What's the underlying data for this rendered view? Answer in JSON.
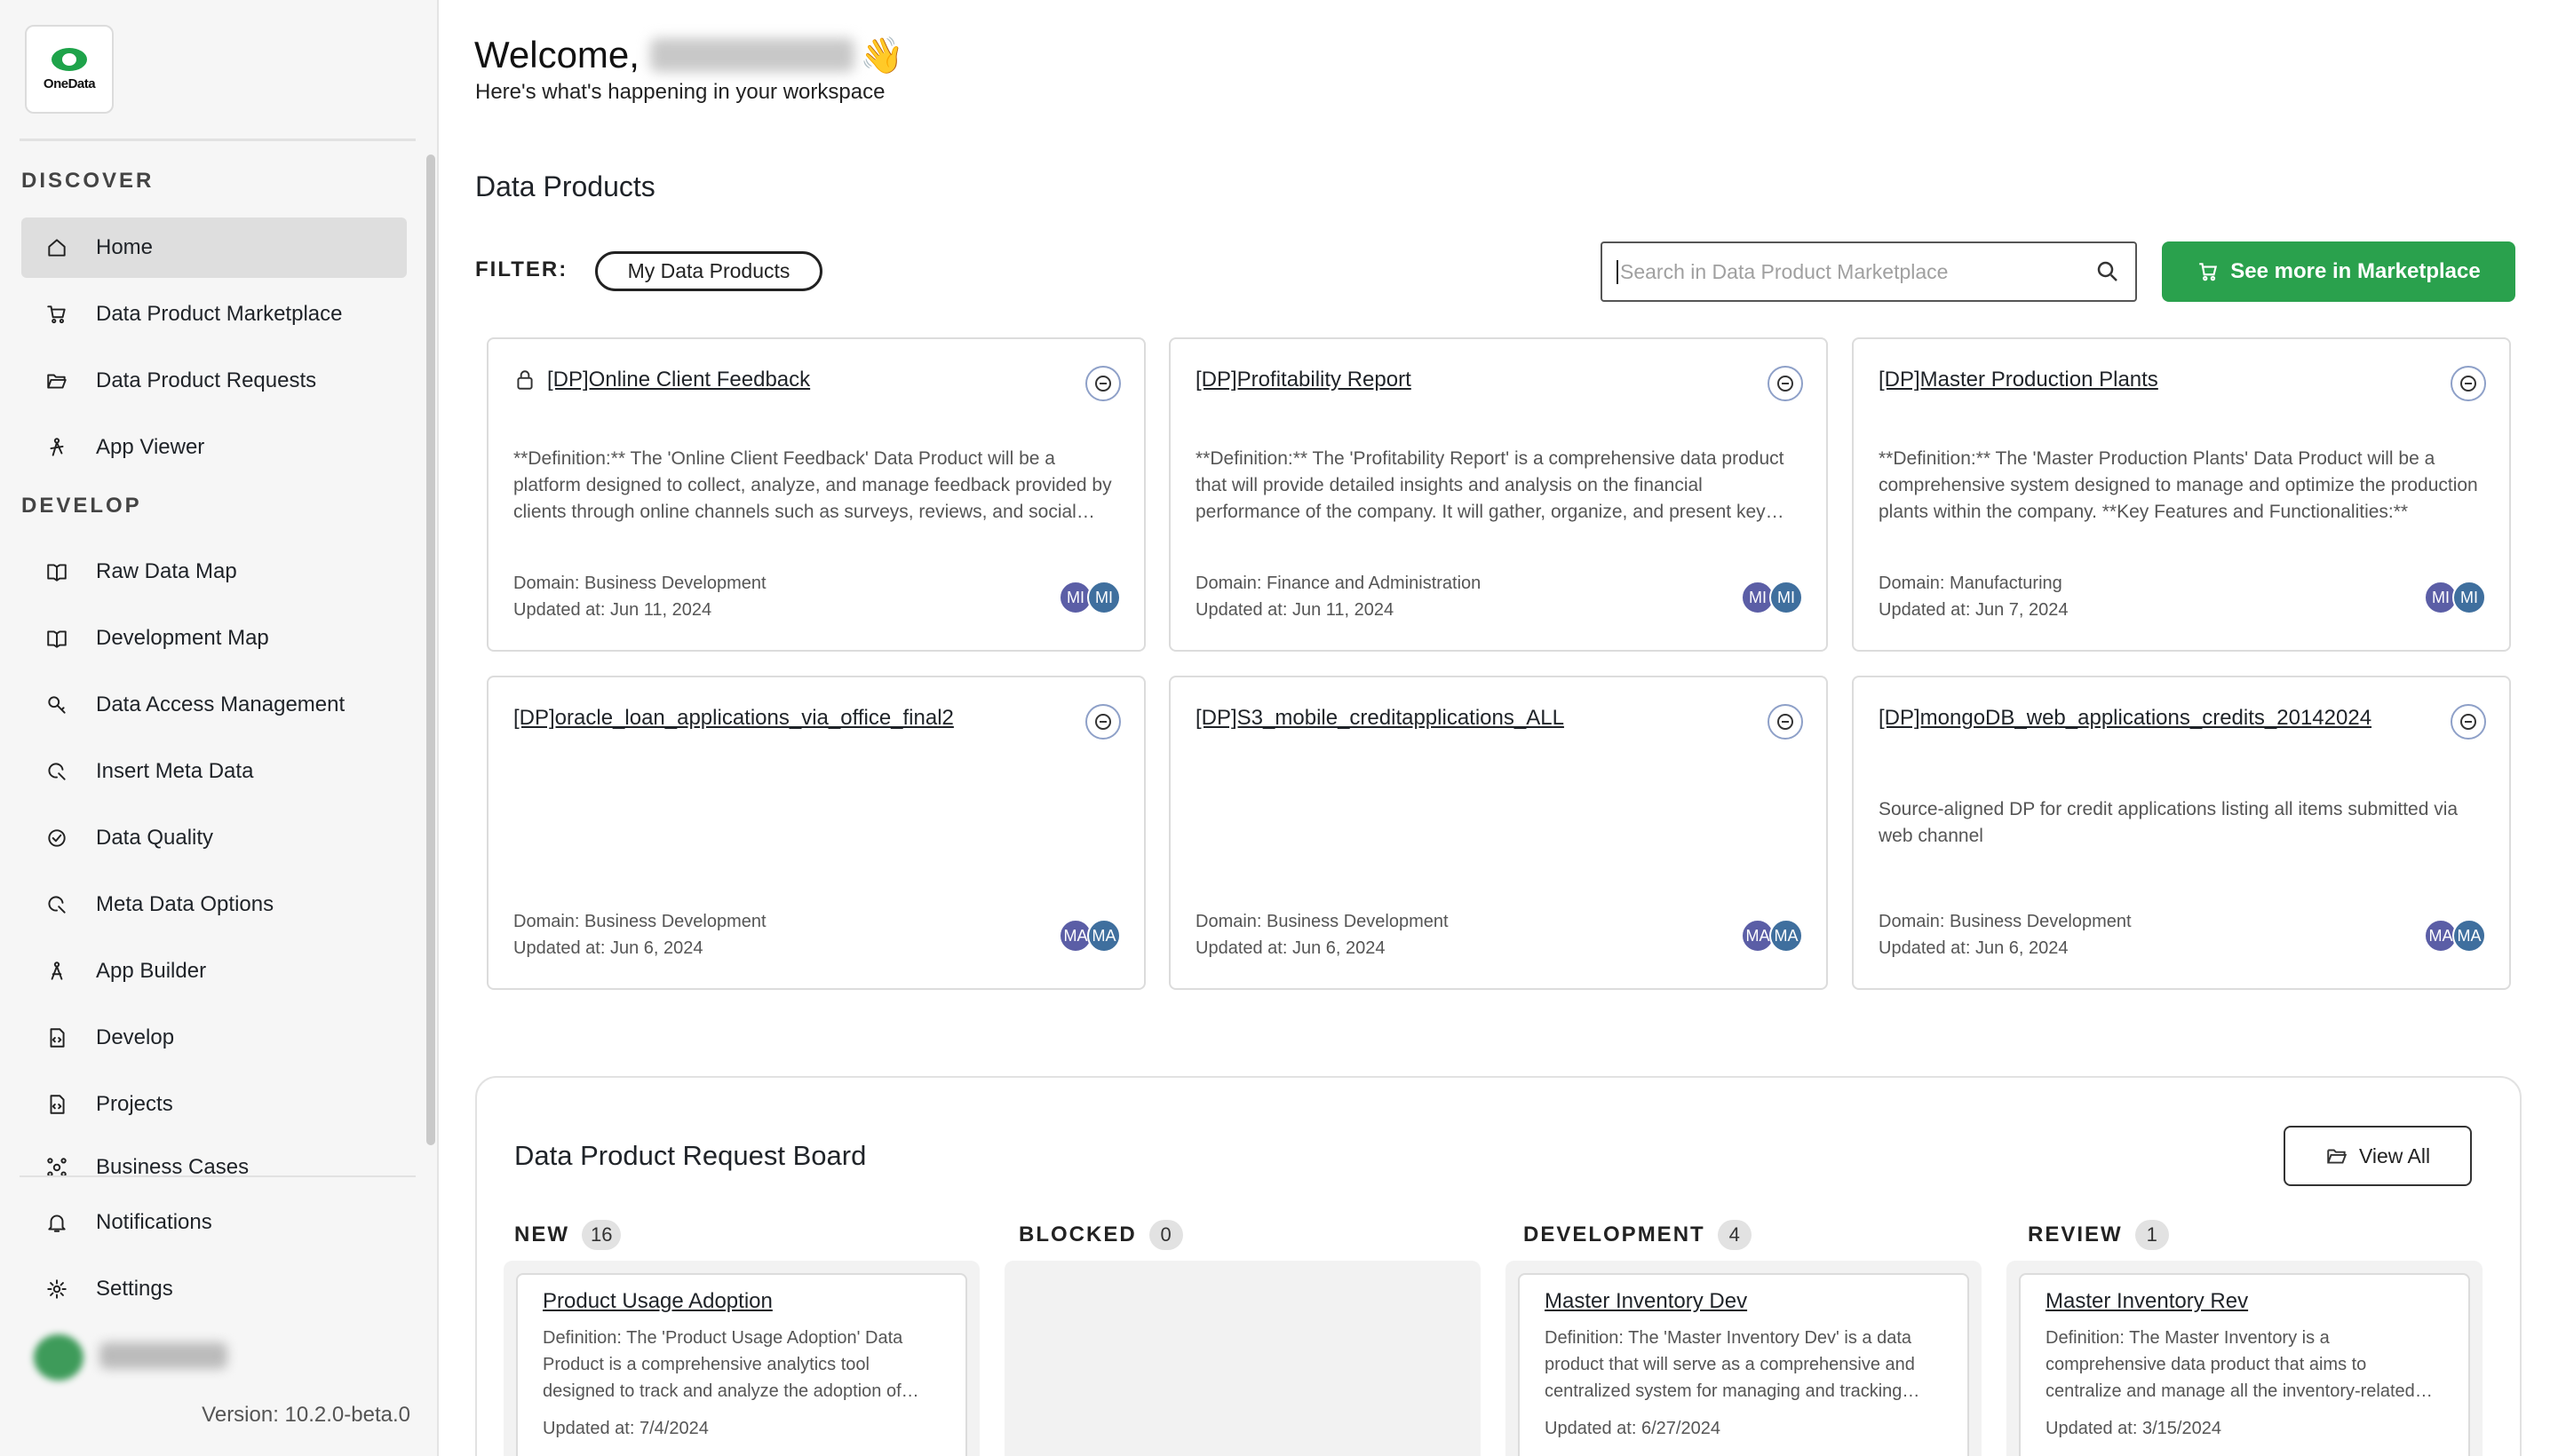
{
  "brand": {
    "logo_text": "OneData",
    "accent": "#2aa14d"
  },
  "sidebar": {
    "discover_label": "DISCOVER",
    "develop_label": "DEVELOP",
    "discover_items": [
      {
        "label": "Home",
        "icon": "home-icon",
        "active": true
      },
      {
        "label": "Data Product Marketplace",
        "icon": "cart-icon"
      },
      {
        "label": "Data Product Requests",
        "icon": "folder-open-icon"
      },
      {
        "label": "App Viewer",
        "icon": "app-viewer-icon"
      }
    ],
    "develop_items": [
      {
        "label": "Raw Data Map",
        "icon": "book-map-icon"
      },
      {
        "label": "Development Map",
        "icon": "book-map-icon"
      },
      {
        "label": "Data Access Management",
        "icon": "key-search-icon"
      },
      {
        "label": "Insert Meta Data",
        "icon": "refresh-search-icon"
      },
      {
        "label": "Data Quality",
        "icon": "check-circle-icon"
      },
      {
        "label": "Meta Data Options",
        "icon": "refresh-search-icon"
      },
      {
        "label": "App Builder",
        "icon": "app-builder-icon"
      },
      {
        "label": "Develop",
        "icon": "code-file-icon"
      },
      {
        "label": "Projects",
        "icon": "code-file-icon"
      },
      {
        "label": "Business Cases",
        "icon": "network-icon"
      }
    ],
    "notifications_label": "Notifications",
    "settings_label": "Settings",
    "version": "Version: 10.2.0-beta.0"
  },
  "main": {
    "welcome": "Welcome,",
    "wave": "👋",
    "subtitle": "Here's what's happening in your workspace",
    "data_products_heading": "Data Products",
    "filter_label": "FILTER:",
    "filter_chip": "My Data Products",
    "search_placeholder": "Search in Data Product Marketplace",
    "marketplace_button": "See more in Marketplace"
  },
  "data_products": [
    {
      "title": "[DP]Online Client Feedback",
      "locked": true,
      "description": "**Definition:** The 'Online Client Feedback' Data Product will be a platform designed to collect, analyze, and manage feedback provided by clients through online channels such as surveys, reviews, and social media.",
      "domain": "Domain: Business Development",
      "updated": "Updated at: Jun 11, 2024",
      "avatars": [
        "MI",
        "MI"
      ]
    },
    {
      "title": "[DP]Profitability Report",
      "locked": false,
      "description": "**Definition:** The 'Profitability Report' is a comprehensive data product that will provide detailed insights and analysis on the financial performance of the company. It will gather, organize, and present key metrics.",
      "domain": "Domain: Finance and Administration",
      "updated": "Updated at: Jun 11, 2024",
      "avatars": [
        "MI",
        "MI"
      ]
    },
    {
      "title": "[DP]Master Production Plants",
      "locked": false,
      "description": "**Definition:** The 'Master Production Plants' Data Product will be a comprehensive system designed to manage and optimize the production plants within the company. **Key Features and Functionalities:**",
      "domain": "Domain: Manufacturing",
      "updated": "Updated at: Jun 7, 2024",
      "avatars": [
        "MI",
        "MI"
      ]
    },
    {
      "title": "[DP]oracle_loan_applications_via_office_final2",
      "locked": false,
      "description": "",
      "domain": "Domain: Business Development",
      "updated": "Updated at: Jun 6, 2024",
      "avatars": [
        "MA",
        "MA"
      ]
    },
    {
      "title": "[DP]S3_mobile_creditapplications_ALL",
      "locked": false,
      "description": "",
      "domain": "Domain: Business Development",
      "updated": "Updated at: Jun 6, 2024",
      "avatars": [
        "MA",
        "MA"
      ]
    },
    {
      "title": "[DP]mongoDB_web_applications_credits_20142024",
      "locked": false,
      "description": "Source-aligned DP for credit applications listing all items submitted via web channel",
      "domain": "Domain: Business Development",
      "updated": "Updated at: Jun 6, 2024",
      "avatars": [
        "MA",
        "MA"
      ]
    }
  ],
  "request_board": {
    "title": "Data Product Request Board",
    "view_all": "View All",
    "columns": [
      {
        "name": "NEW",
        "count": "16",
        "card": {
          "title": "Product Usage Adoption",
          "description": "Definition: The 'Product Usage Adoption' Data Product is a comprehensive analytics tool designed to track and analyze the adoption of products.",
          "updated": "Updated at: 7/4/2024"
        }
      },
      {
        "name": "BLOCKED",
        "count": "0",
        "card": null
      },
      {
        "name": "DEVELOPMENT",
        "count": "4",
        "card": {
          "title": "Master Inventory Dev",
          "description": "Definition: The 'Master Inventory Dev' is a data product that will serve as a comprehensive and centralized system for managing and tracking inventory.",
          "updated": "Updated at: 6/27/2024"
        }
      },
      {
        "name": "REVIEW",
        "count": "1",
        "card": {
          "title": "Master Inventory Rev",
          "description": "Definition: The Master Inventory is a comprehensive data product that aims to centralize and manage all the inventory-related data.",
          "updated": "Updated at: 3/15/2024"
        }
      }
    ]
  }
}
